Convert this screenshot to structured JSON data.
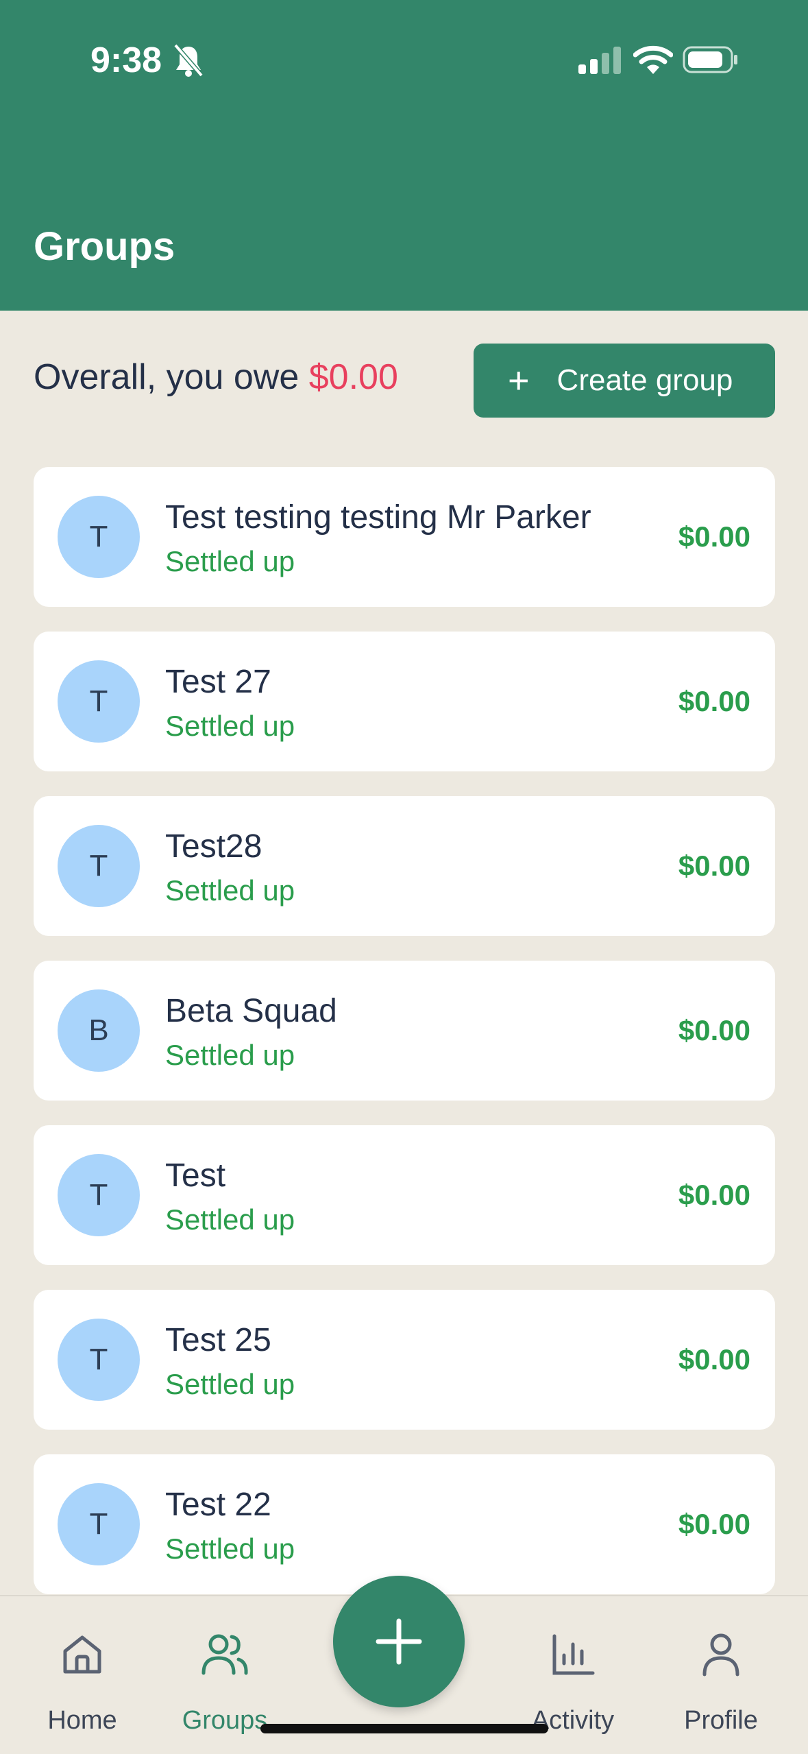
{
  "status_bar": {
    "time": "9:38"
  },
  "header": {
    "title": "Groups"
  },
  "summary": {
    "prefix": "Overall, you owe ",
    "amount": "$0.00"
  },
  "create_group": {
    "icon": "plus-icon",
    "label": "Create group"
  },
  "groups": [
    {
      "initial": "T",
      "name": "Test testing testing Mr Parker",
      "status": "Settled up",
      "amount": "$0.00"
    },
    {
      "initial": "T",
      "name": "Test 27",
      "status": "Settled up",
      "amount": "$0.00"
    },
    {
      "initial": "T",
      "name": "Test28",
      "status": "Settled up",
      "amount": "$0.00"
    },
    {
      "initial": "B",
      "name": "Beta Squad",
      "status": "Settled up",
      "amount": "$0.00"
    },
    {
      "initial": "T",
      "name": "Test",
      "status": "Settled up",
      "amount": "$0.00"
    },
    {
      "initial": "T",
      "name": "Test 25",
      "status": "Settled up",
      "amount": "$0.00"
    },
    {
      "initial": "T",
      "name": "Test 22",
      "status": "Settled up",
      "amount": "$0.00"
    }
  ],
  "tabbar": {
    "home": {
      "label": "Home",
      "icon": "home-icon"
    },
    "groups": {
      "label": "Groups",
      "icon": "users-icon",
      "active": true
    },
    "add": {
      "icon": "plus-icon"
    },
    "activity": {
      "label": "Activity",
      "icon": "bar-chart-icon"
    },
    "profile": {
      "label": "Profile",
      "icon": "user-icon"
    }
  },
  "colors": {
    "brand": "#33866a",
    "background": "#ede9e0",
    "owe": "#e8405e",
    "settled": "#2a9d4c",
    "avatar": "#a9d4fb",
    "text": "#243048",
    "tab_inactive": "#3d4657"
  }
}
